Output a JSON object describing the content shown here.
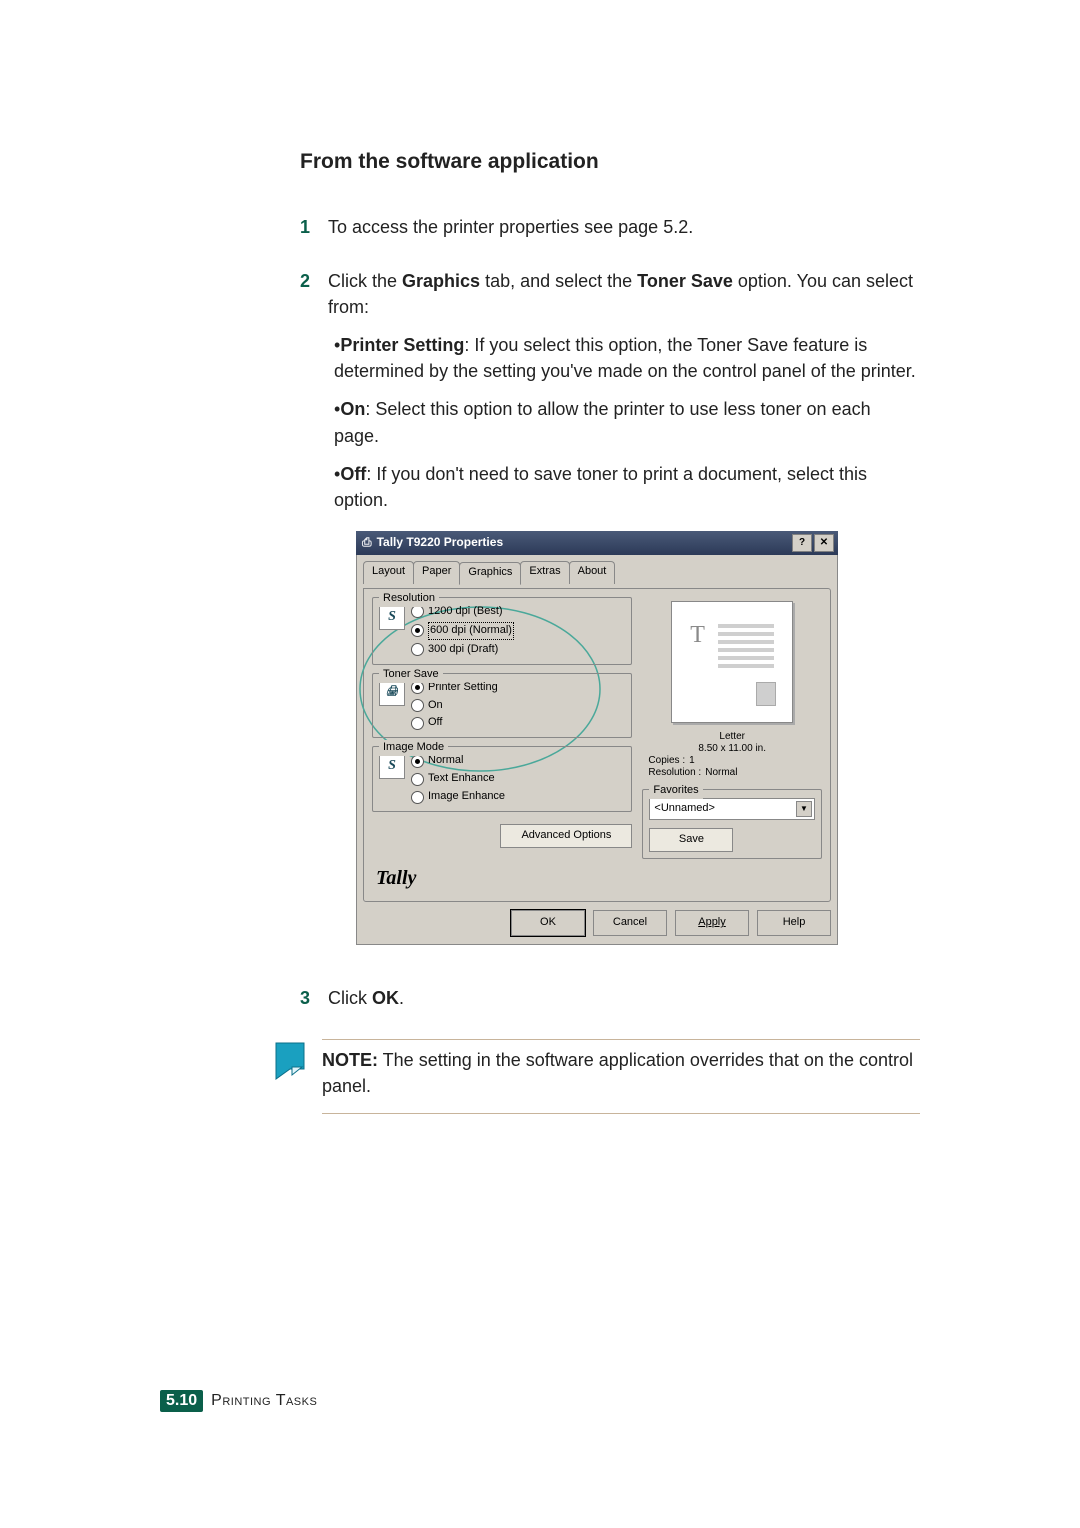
{
  "heading": "From the software application",
  "steps": {
    "s1_num": "1",
    "s1": "To access the printer properties see page 5.2.",
    "s2_num": "2",
    "s2_lead1": "Click the ",
    "s2_bold1": "Graphics",
    "s2_mid": " tab, and select the ",
    "s2_bold2": "Toner Save",
    "s2_tail": " option. You can select from:",
    "b1_label": "Printer Setting",
    "b1_text": ": If you select this option, the Toner Save feature is determined by the setting you've made on the control panel of the printer.",
    "b2_label": "On",
    "b2_text": ": Select this option to allow the printer to use less toner on each page.",
    "b3_label": "Off",
    "b3_text": ": If you don't need to save toner to print a document, select this option.",
    "s3_num": "3",
    "s3_lead": "Click ",
    "s3_bold": "OK",
    "s3_tail": "."
  },
  "dialog": {
    "title": "Tally T9220 Properties",
    "tabs": [
      "Layout",
      "Paper",
      "Graphics",
      "Extras",
      "About"
    ],
    "active_tab": 2,
    "groups": {
      "resolution": {
        "legend": "Resolution",
        "icon": "S",
        "options": [
          "1200 dpi (Best)",
          "600 dpi (Normal)",
          "300 dpi (Draft)"
        ],
        "selected": 1
      },
      "toner_save": {
        "legend": "Toner Save",
        "options": [
          "Printer Setting",
          "On",
          "Off"
        ],
        "selected": 0
      },
      "image_mode": {
        "legend": "Image Mode",
        "icon": "S",
        "options": [
          "Normal",
          "Text Enhance",
          "Image Enhance"
        ],
        "selected": 0
      }
    },
    "advanced_btn": "Advanced Options",
    "brand": "Tally",
    "meta": {
      "paper_name": "Letter",
      "paper_size": "8.50 x 11.00 in.",
      "copies_label": "Copies :",
      "copies_value": "1",
      "res_label": "Resolution :",
      "res_value": "Normal"
    },
    "favorites": {
      "legend": "Favorites",
      "value": "<Unnamed>",
      "save": "Save"
    },
    "buttons": {
      "ok": "OK",
      "cancel": "Cancel",
      "apply": "Apply",
      "help": "Help"
    }
  },
  "note": {
    "label": "NOTE:",
    "text": " The setting in the software application overrides that on the control panel."
  },
  "footer": {
    "chapter": "5.",
    "page": "10",
    "title": "Printing Tasks"
  }
}
